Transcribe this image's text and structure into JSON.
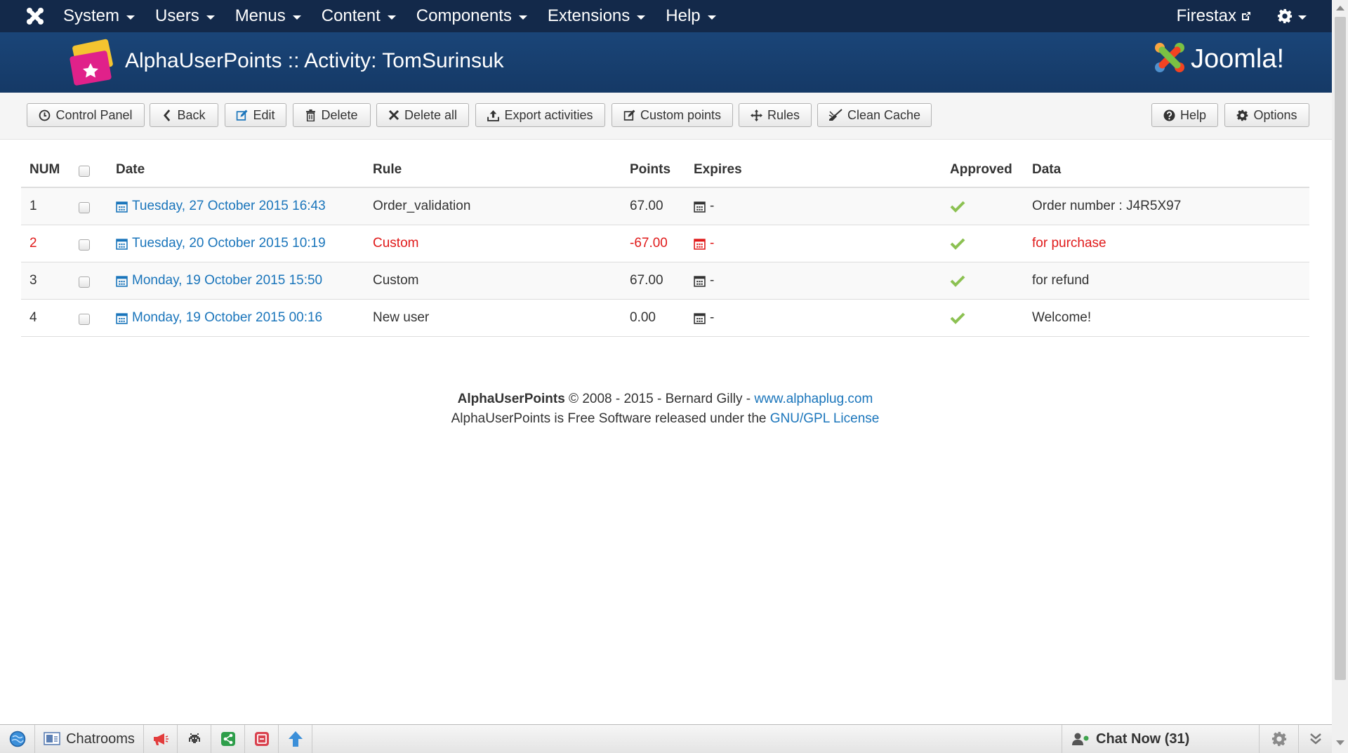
{
  "topbar": {
    "logo_icon": "joomla-icon",
    "menu": [
      "System",
      "Users",
      "Menus",
      "Content",
      "Components",
      "Extensions",
      "Help"
    ],
    "user_label": "Firestax",
    "gear_icon": "gear-icon"
  },
  "header": {
    "title": "AlphaUserPoints :: Activity: TomSurinsuk",
    "brand_text": "Joomla!"
  },
  "toolbar": {
    "buttons": [
      {
        "label": "Control Panel",
        "icon": "control-panel-icon"
      },
      {
        "label": "Back",
        "icon": "chevron-left-icon"
      },
      {
        "label": "Edit",
        "icon": "edit-icon"
      },
      {
        "label": "Delete",
        "icon": "trash-icon"
      },
      {
        "label": "Delete all",
        "icon": "close-icon"
      },
      {
        "label": "Export activities",
        "icon": "upload-icon"
      },
      {
        "label": "Custom points",
        "icon": "edit-icon"
      },
      {
        "label": "Rules",
        "icon": "move-icon"
      },
      {
        "label": "Clean Cache",
        "icon": "broom-icon"
      }
    ],
    "right_buttons": [
      {
        "label": "Help",
        "icon": "question-icon"
      },
      {
        "label": "Options",
        "icon": "gear-icon"
      }
    ]
  },
  "table": {
    "headers": {
      "num": "NUM",
      "date": "Date",
      "rule": "Rule",
      "points": "Points",
      "expires": "Expires",
      "approved": "Approved",
      "data": "Data"
    },
    "rows": [
      {
        "num": "1",
        "date": "Tuesday, 27 October 2015 16:43",
        "rule": "Order_validation",
        "points": "67.00",
        "expires": "-",
        "approved": true,
        "data": "Order number : J4R5X97",
        "negative": false
      },
      {
        "num": "2",
        "date": "Tuesday, 20 October 2015 10:19",
        "rule": "Custom",
        "points": "-67.00",
        "expires": "-",
        "approved": true,
        "data": "for purchase",
        "negative": true
      },
      {
        "num": "3",
        "date": "Monday, 19 October 2015 15:50",
        "rule": "Custom",
        "points": "67.00",
        "expires": "-",
        "approved": true,
        "data": "for refund",
        "negative": false
      },
      {
        "num": "4",
        "date": "Monday, 19 October 2015 00:16",
        "rule": "New user",
        "points": "0.00",
        "expires": "-",
        "approved": true,
        "data": "Welcome!",
        "negative": false
      }
    ]
  },
  "footer": {
    "product": "AlphaUserPoints",
    "copyright": "© 2008 - 2015 - Bernard Gilly -",
    "site_link": "www.alphaplug.com",
    "license_text": "AlphaUserPoints is Free Software released under the",
    "license_link": "GNU/GPL License"
  },
  "chatbar": {
    "chatrooms_label": "Chatrooms",
    "chat_now_label": "Chat Now (31)"
  },
  "colors": {
    "topbar_bg": "#13294a",
    "header_bg": "#1a4578",
    "link": "#1a75bb",
    "negative": "#e01a1a",
    "approved": "#8cc152"
  }
}
